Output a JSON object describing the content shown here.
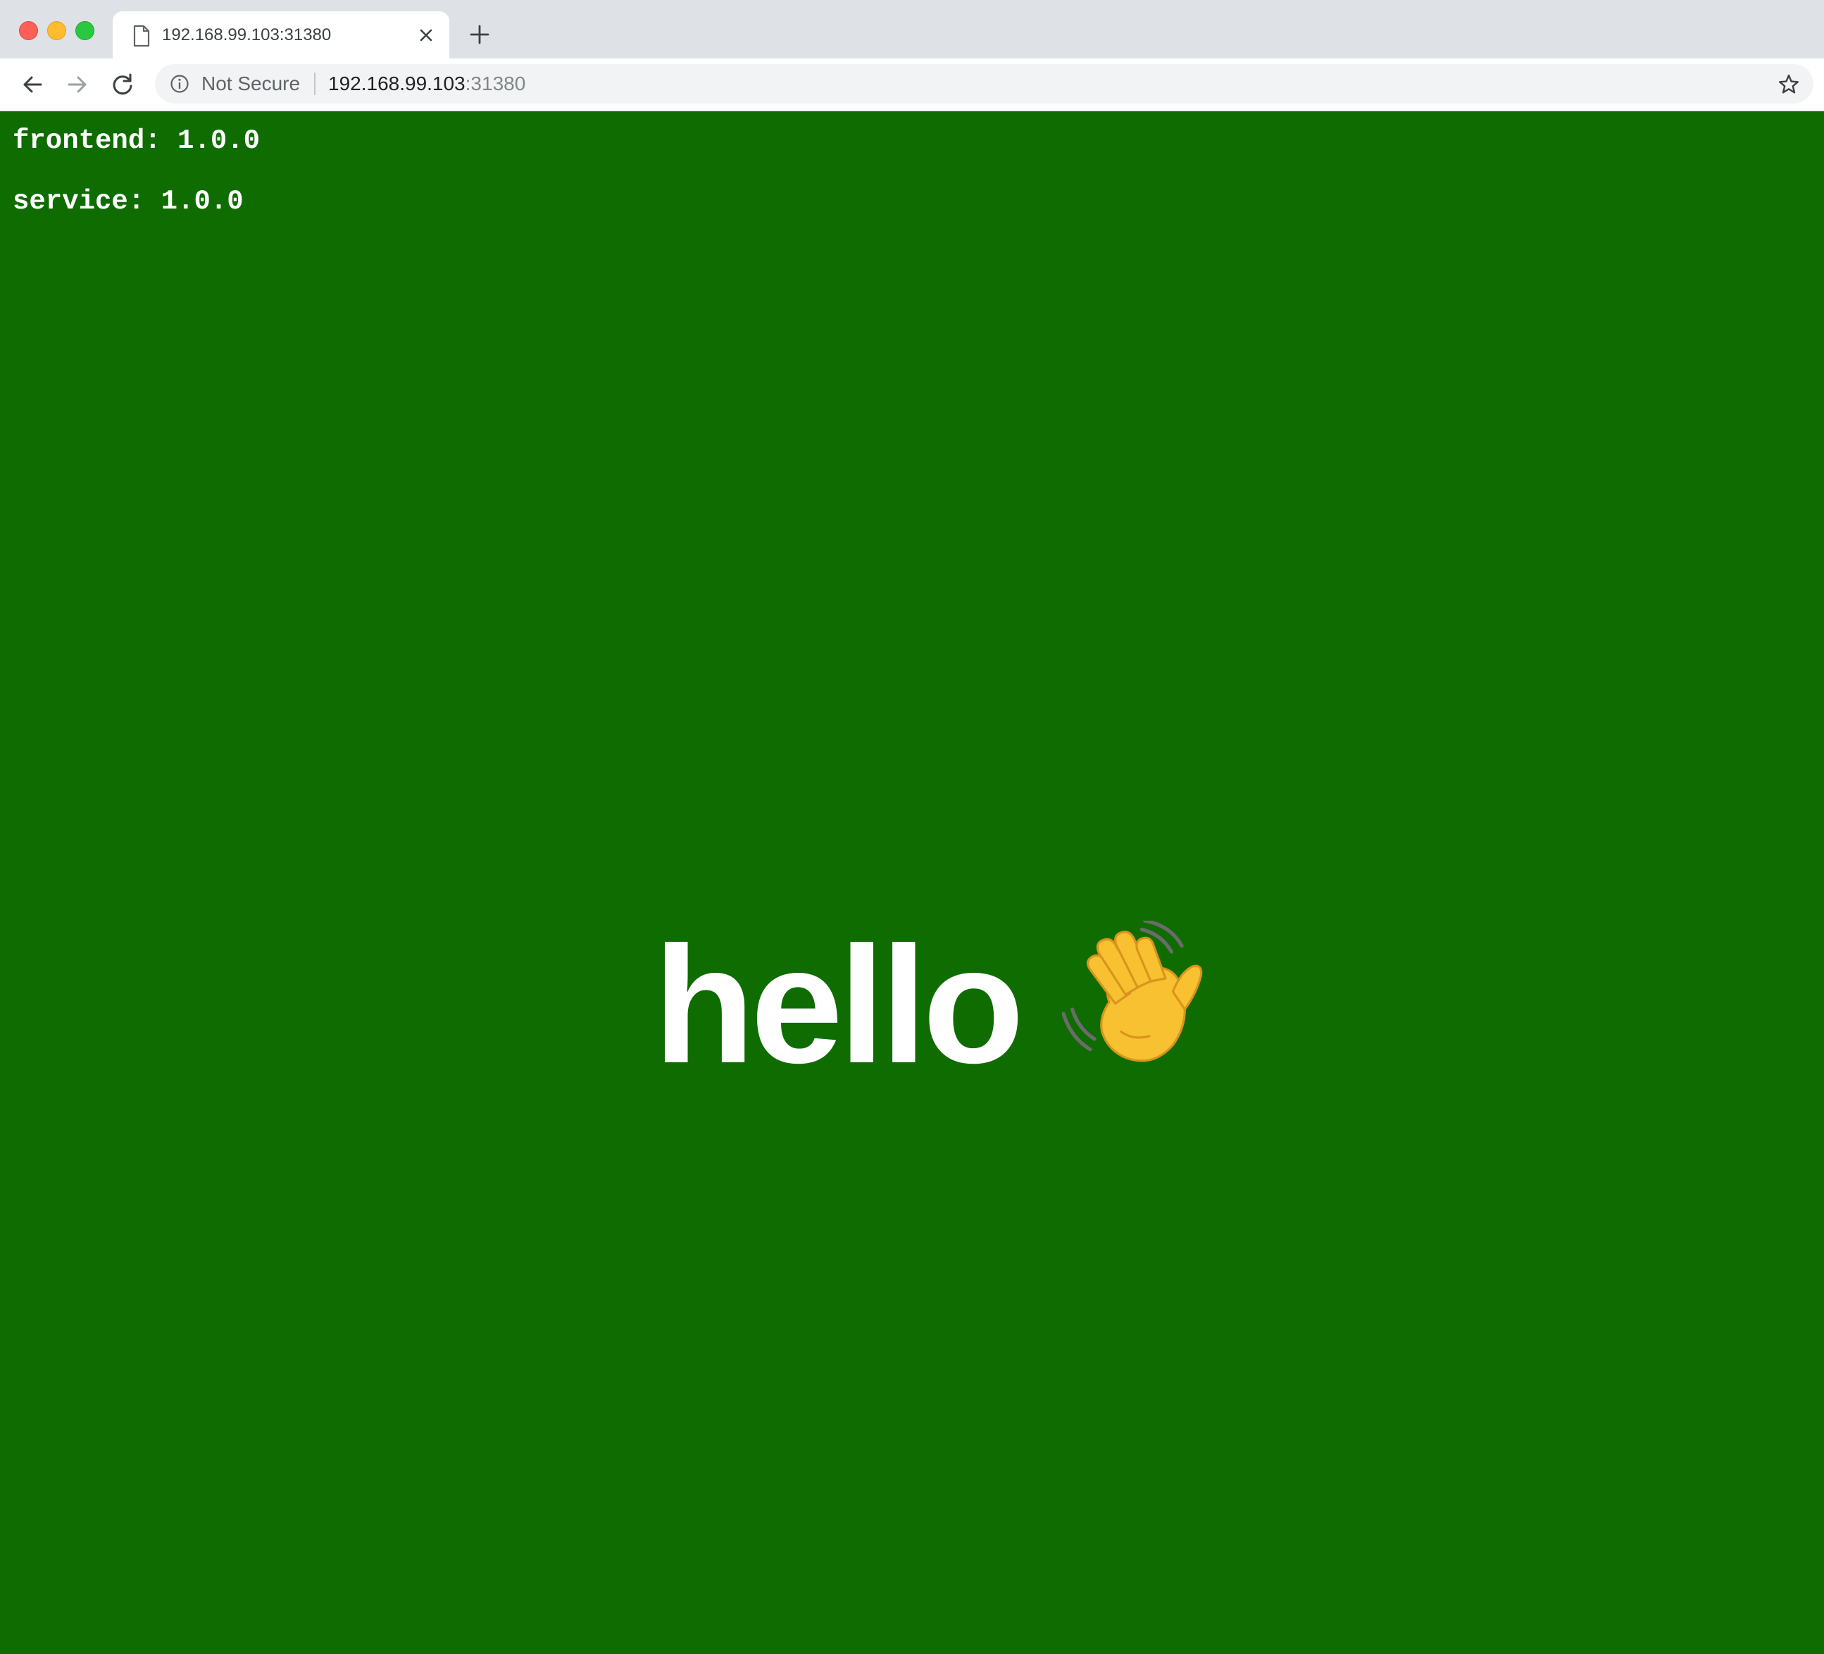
{
  "browser": {
    "tab": {
      "title": "192.168.99.103:31380",
      "favicon": "document-icon"
    },
    "omnibox": {
      "security_label": "Not Secure",
      "url_host": "192.168.99.103",
      "url_port": ":31380"
    }
  },
  "page": {
    "background_color": "#0f6c00",
    "text_color": "#ffffff",
    "versions": {
      "frontend": "frontend: 1.0.0",
      "service": "service: 1.0.0"
    },
    "greeting": {
      "text": "hello",
      "icon": "waving-hand-icon"
    }
  }
}
